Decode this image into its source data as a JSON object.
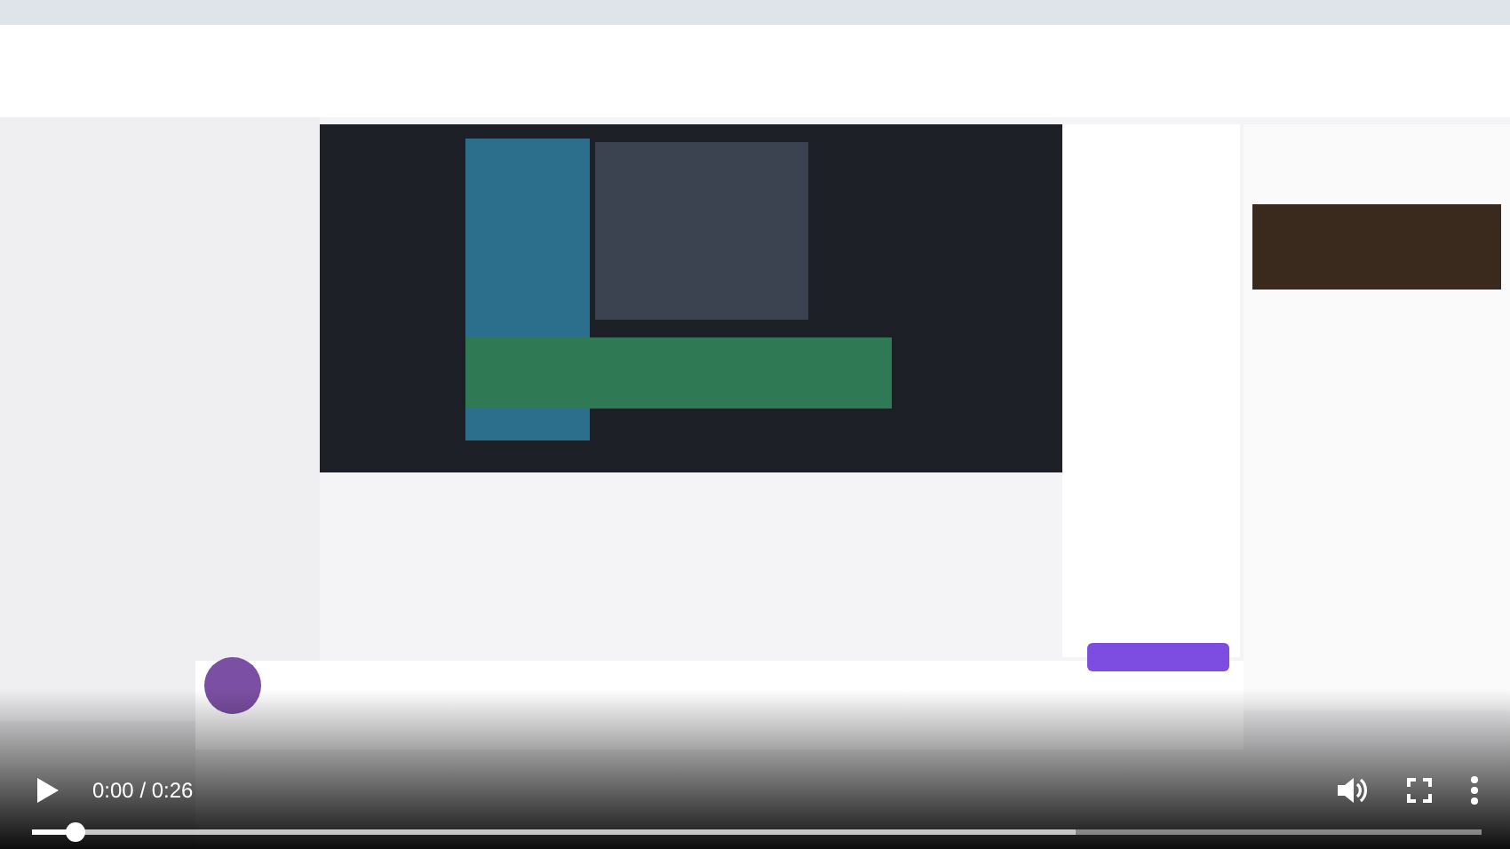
{
  "player": {
    "time": "0:00 / 0:26",
    "progress": {
      "level": 0.03
    }
  }
}
